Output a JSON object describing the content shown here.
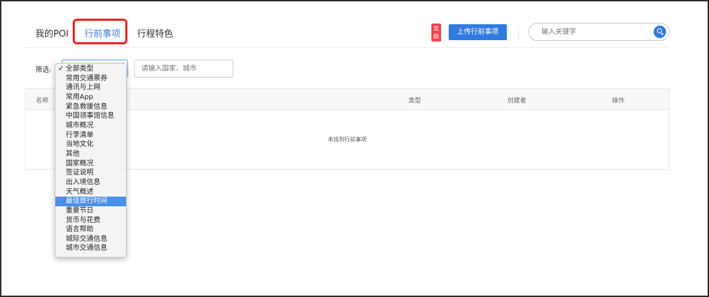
{
  "tabs": {
    "poi": "我的POI",
    "active": "行前事项",
    "feature": "行程特色"
  },
  "badge": "奖励",
  "upload_label": "上传行前事项",
  "search": {
    "placeholder": "输入关键字"
  },
  "filter": {
    "label": "筛选:",
    "city_placeholder": "请输入国家、城市",
    "options": [
      "全部类型",
      "常用交通票券",
      "通讯与上网",
      "常用App",
      "紧急救援信息",
      "中国领事馆信息",
      "城市概况",
      "行李清单",
      "当地文化",
      "其他",
      "国家概况",
      "签证说明",
      "出入境信息",
      "天气概述",
      "最佳旅行时间",
      "重要节日",
      "货币与花费",
      "语言帮助",
      "城际交通信息",
      "城市交通信息"
    ],
    "checked_index": 0,
    "highlighted_index": 14
  },
  "table": {
    "headers": {
      "name": "名称",
      "type": "类型",
      "creator": "创建者",
      "ops": "操作"
    },
    "empty_text": "未找到行前事项"
  },
  "colors": {
    "accent": "#2f7be0",
    "highlight": "#e8201d",
    "badge": "#f0444f"
  }
}
